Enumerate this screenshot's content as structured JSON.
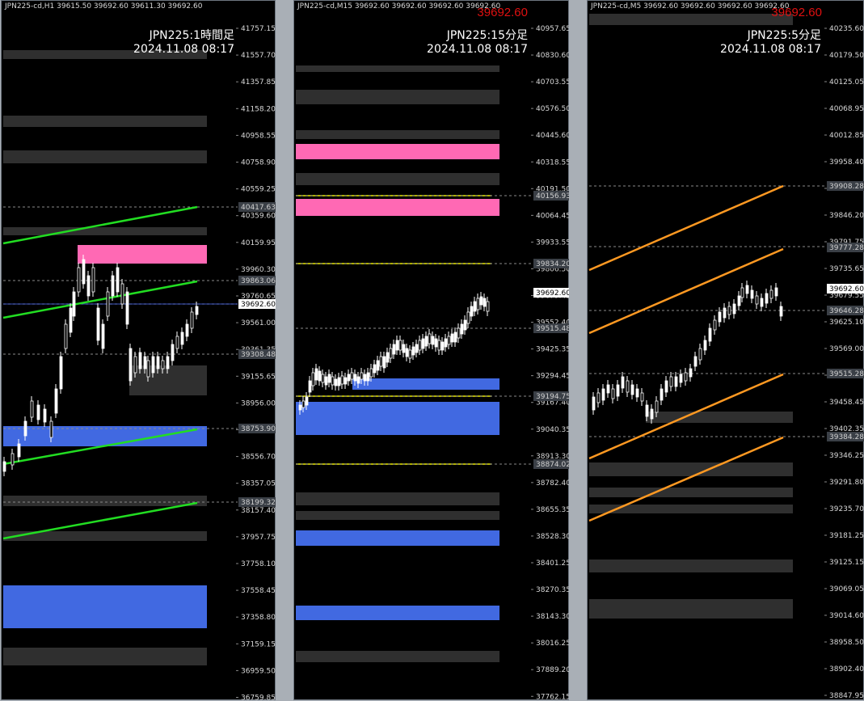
{
  "colors": {
    "background": "#000000",
    "frame": "#a9afb6",
    "zone_gray": "#2f2f2f",
    "zone_pink": "#ff69b4",
    "zone_blue": "#4169e1",
    "trend_green": "#22dd22",
    "trend_orange": "#ff9922",
    "level_yellow": "#e8e800",
    "price_red": "#e01010",
    "candle_up": "#ffffff",
    "axis_text": "#d8d8d8"
  },
  "charts": [
    {
      "symbol_header": "JPN225-cd,H1  39615.50 39692.60 39611.30 39692.60",
      "title": "JPN225:1時間足",
      "datetime": "2024.11.08 08:17",
      "current_price_red": "",
      "axis_ticks": [
        "41757.15",
        "41557.70",
        "41357.85",
        "41158.20",
        "40958.55",
        "40758.90",
        "40559.25",
        "40359.60",
        "40159.95",
        "39960.30",
        "39760.65",
        "39561.00",
        "39361.35",
        "39155.65",
        "38956.00",
        "38756.35",
        "38556.70",
        "38357.05",
        "38157.40",
        "37957.75",
        "37758.10",
        "37558.45",
        "37358.80",
        "37159.15",
        "36959.50",
        "36759.85"
      ],
      "markers": [
        "40417.63",
        "39863.06",
        "39692.60",
        "39308.48",
        "38753.90",
        "38199.32"
      ]
    },
    {
      "symbol_header": "JPN225-cd,M15  39692.60 39692.60 39692.60 39692.60",
      "title": "JPN225:15分足",
      "datetime": "2024.11.08 08:17",
      "current_price_red": "39692.60",
      "axis_ticks": [
        "40957.65",
        "40830.60",
        "40703.55",
        "40576.50",
        "40445.60",
        "40318.55",
        "40191.50",
        "40064.45",
        "39933.55",
        "39806.50",
        "39679.45",
        "39552.40",
        "39425.35",
        "39294.45",
        "39167.40",
        "39040.35",
        "38913.30",
        "38782.40",
        "38655.35",
        "38528.30",
        "38401.25",
        "38270.35",
        "38143.30",
        "38016.25",
        "37889.20",
        "37762.15"
      ],
      "markers": [
        "40156.93",
        "39834.20",
        "39692.60",
        "39515.48",
        "39194.75",
        "38874.02"
      ]
    },
    {
      "symbol_header": "JPN225-cd,M5  39692.60 39692.60 39692.60 39692.60",
      "title": "JPN225:5分足",
      "datetime": "2024.11.08 08:17",
      "current_price_red": "39692.60",
      "axis_ticks": [
        "40235.60",
        "40179.50",
        "40125.05",
        "40068.95",
        "40012.85",
        "39958.40",
        "39902.30",
        "39846.20",
        "39791.75",
        "39735.65",
        "39679.55",
        "39625.10",
        "39569.00",
        "39514.55",
        "39458.45",
        "39402.35",
        "39346.25",
        "39291.80",
        "39235.70",
        "39181.25",
        "39125.15",
        "39069.05",
        "39014.60",
        "38958.50",
        "38902.40",
        "38847.95"
      ],
      "markers": [
        "39908.28",
        "39777.28",
        "39692.60",
        "39646.28",
        "39515.28",
        "39384.28"
      ]
    }
  ]
}
